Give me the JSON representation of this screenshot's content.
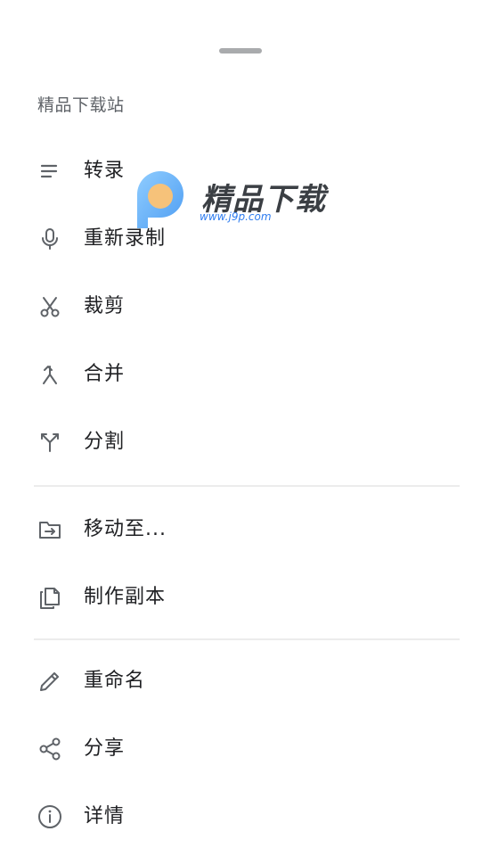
{
  "sheet": {
    "title": "精品下载站"
  },
  "menu_group_1": [
    {
      "label": "转录",
      "icon": "notes-lines-icon"
    },
    {
      "label": "重新录制",
      "icon": "microphone-icon"
    },
    {
      "label": "裁剪",
      "icon": "scissors-icon"
    },
    {
      "label": "合并",
      "icon": "merge-icon"
    },
    {
      "label": "分割",
      "icon": "split-icon"
    }
  ],
  "menu_group_2": [
    {
      "label": "移动至...",
      "icon": "folder-move-icon"
    },
    {
      "label": "制作副本",
      "icon": "copy-icon"
    }
  ],
  "menu_group_3": [
    {
      "label": "重命名",
      "icon": "pencil-icon"
    },
    {
      "label": "分享",
      "icon": "share-icon"
    },
    {
      "label": "详情",
      "icon": "info-icon"
    }
  ],
  "watermark": {
    "text": "精品下载",
    "url": "www.j9p.com"
  },
  "colors": {
    "icon": "#5f6368",
    "divider": "#ececec",
    "handle": "#a9abad"
  }
}
